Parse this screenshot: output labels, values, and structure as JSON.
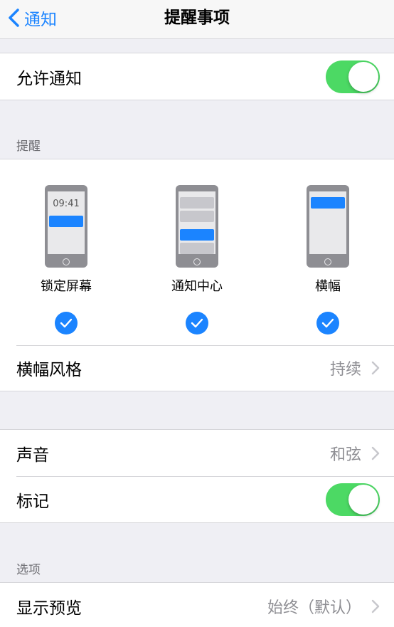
{
  "nav": {
    "back_label": "通知",
    "title": "提醒事项"
  },
  "allow_notifications": {
    "label": "允许通知",
    "enabled": true
  },
  "alerts_section": {
    "header": "提醒",
    "styles": [
      {
        "label": "锁定屏幕",
        "checked": true,
        "time": "09:41"
      },
      {
        "label": "通知中心",
        "checked": true
      },
      {
        "label": "横幅",
        "checked": true
      }
    ],
    "banner_style": {
      "label": "横幅风格",
      "value": "持续"
    }
  },
  "sound_badges": {
    "sound": {
      "label": "声音",
      "value": "和弦"
    },
    "badges": {
      "label": "标记",
      "enabled": true
    }
  },
  "options_section": {
    "header": "选项",
    "show_previews": {
      "label": "显示预览",
      "value": "始终（默认）"
    }
  },
  "colors": {
    "accent": "#1b84ff",
    "toggle_on": "#4cd964",
    "background": "#efeff4",
    "secondary_text": "#8e8e93"
  },
  "icons": {
    "back": "chevron-left-icon",
    "disclosure": "chevron-right-icon",
    "check": "checkmark-icon"
  }
}
